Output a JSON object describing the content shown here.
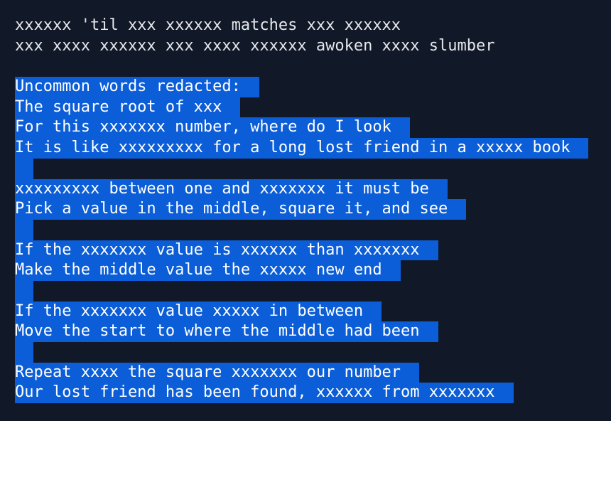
{
  "terminal": {
    "lines": [
      {
        "text": "xxxxxx 'til xxx xxxxxx matches xxx xxxxxx",
        "selected": false
      },
      {
        "text": "xxx xxxx xxxxxx xxx xxxx xxxxxx awoken xxxx slumber",
        "selected": false
      },
      {
        "text": "",
        "selected": false
      },
      {
        "text": "Uncommon words redacted:",
        "selected": true
      },
      {
        "text": "The square root of xxx",
        "selected": true
      },
      {
        "text": "For this xxxxxxx number, where do I look",
        "selected": true
      },
      {
        "text": "It is like xxxxxxxxx for a long lost friend in a xxxxx book",
        "selected": true
      },
      {
        "text": "",
        "selected": true
      },
      {
        "text": "xxxxxxxxx between one and xxxxxxx it must be",
        "selected": true
      },
      {
        "text": "Pick a value in the middle, square it, and see",
        "selected": true
      },
      {
        "text": "",
        "selected": true
      },
      {
        "text": "If the xxxxxxx value is xxxxxx than xxxxxxx",
        "selected": true
      },
      {
        "text": "Make the middle value the xxxxx new end",
        "selected": true
      },
      {
        "text": "",
        "selected": true
      },
      {
        "text": "If the xxxxxxx value xxxxx in between",
        "selected": true
      },
      {
        "text": "Move the start to where the middle had been",
        "selected": true
      },
      {
        "text": "",
        "selected": true
      },
      {
        "text": "Repeat xxxx the square xxxxxxx our number",
        "selected": true
      },
      {
        "text": "Our lost friend has been found, xxxxxx from xxxxxxx",
        "selected": true
      }
    ]
  },
  "colors": {
    "background": "#111827",
    "text": "#e5e7eb",
    "selection": "#0b5ed7",
    "page": "#ffffff"
  }
}
